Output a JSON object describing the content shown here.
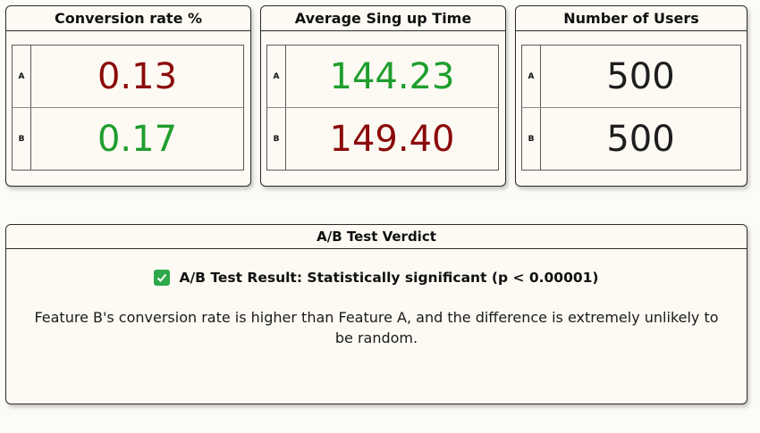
{
  "cards": [
    {
      "title": "Conversion rate %",
      "rows": [
        {
          "label": "A",
          "value": "0.13",
          "color": "#8b0a0a"
        },
        {
          "label": "B",
          "value": "0.17",
          "color": "#1f9e2d"
        }
      ]
    },
    {
      "title": "Average Sing up Time",
      "rows": [
        {
          "label": "A",
          "value": "144.23",
          "color": "#1f9e2d"
        },
        {
          "label": "B",
          "value": "149.40",
          "color": "#8b0a0a"
        }
      ]
    },
    {
      "title": "Number of Users",
      "rows": [
        {
          "label": "A",
          "value": "500",
          "color": "#1e1e1e"
        },
        {
          "label": "B",
          "value": "500",
          "color": "#1e1e1e"
        }
      ]
    }
  ],
  "verdict": {
    "title": "A/B Test Verdict",
    "icon": "check-icon",
    "result": "A/B Test Result: Statistically significant (p < 0.00001)",
    "description": "Feature B's conversion rate is higher than Feature A, and the difference is extremely unlikely to be random."
  }
}
